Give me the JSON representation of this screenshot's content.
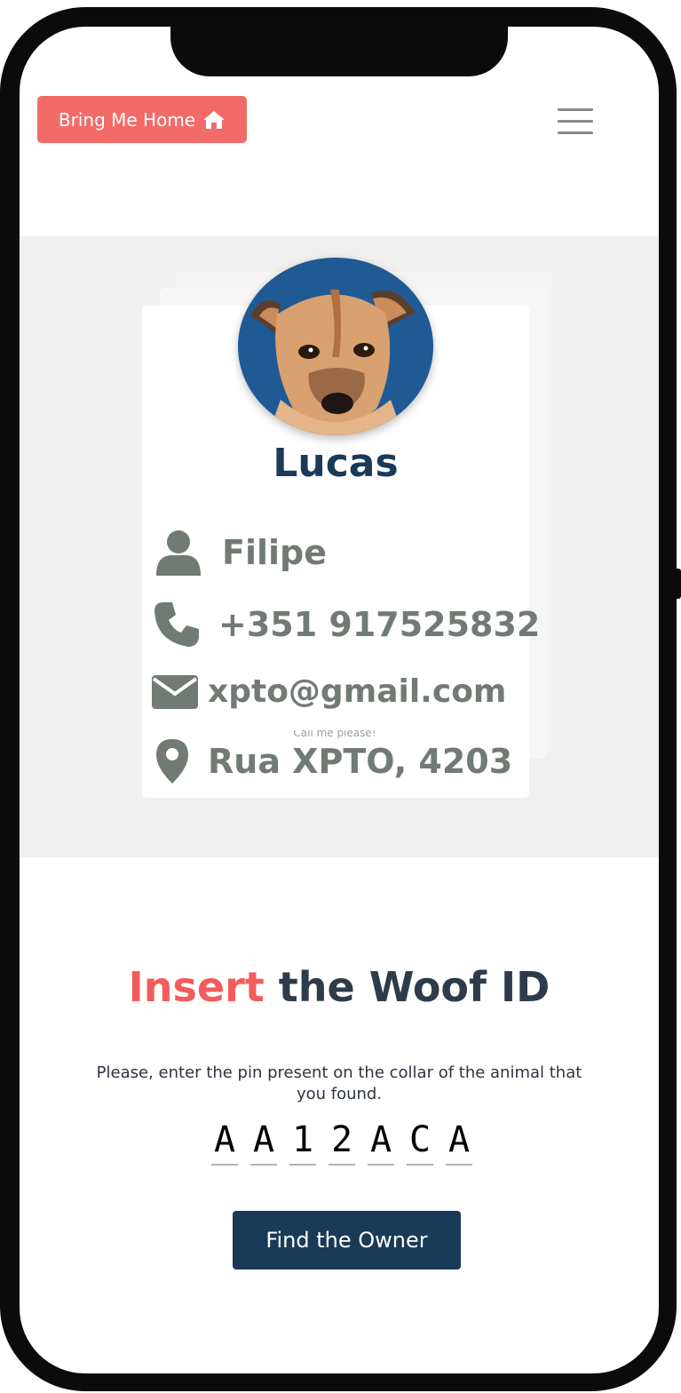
{
  "header": {
    "home_button_label": "Bring Me Home",
    "home_icon": "home-icon",
    "menu_icon": "hamburger-menu-icon"
  },
  "pet_card": {
    "pet_name": "Lucas",
    "avatar": "dog-avatar",
    "owner_name": "Filipe",
    "phone": "+351 917525832",
    "email": "xpto@gmail.com",
    "address": "Rua XPTO, 4203",
    "note": "Call me please!"
  },
  "woof_id": {
    "title_accent": "Insert",
    "title_rest": "the Woof ID",
    "description": "Please, enter the pin present on the collar of the animal that you found.",
    "pin": [
      "A",
      "A",
      "1",
      "2",
      "A",
      "C",
      "A"
    ],
    "submit_label": "Find the Owner"
  },
  "colors": {
    "accent": "#f26b69",
    "navy": "#1a3a58",
    "info_gray": "#717b73",
    "avatar_bg": "#1f5a95"
  }
}
